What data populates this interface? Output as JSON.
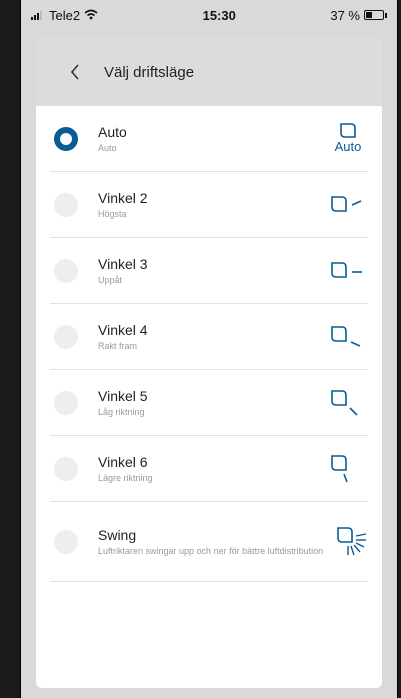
{
  "status_bar": {
    "carrier": "Tele2",
    "time": "15:30",
    "battery": "37 %"
  },
  "header": {
    "title": "Välj driftsläge"
  },
  "modes": [
    {
      "label": "Auto",
      "sublabel": "Auto",
      "selected": true,
      "icon": "auto-mode-icon",
      "icon_text": "Auto"
    },
    {
      "label": "Vinkel 2",
      "sublabel": "Högsta",
      "selected": false,
      "icon": "angle-2-icon"
    },
    {
      "label": "Vinkel 3",
      "sublabel": "Uppåt",
      "selected": false,
      "icon": "angle-3-icon"
    },
    {
      "label": "Vinkel  4",
      "sublabel": "Rakt fram",
      "selected": false,
      "icon": "angle-4-icon"
    },
    {
      "label": "Vinkel  5",
      "sublabel": "Låg riktning",
      "selected": false,
      "icon": "angle-5-icon"
    },
    {
      "label": "Vinkel  6",
      "sublabel": "Lägre riktning",
      "selected": false,
      "icon": "angle-6-icon"
    },
    {
      "label": "Swing",
      "sublabel": "Luftriktaren swingar upp och ner för bättre luftdistribution",
      "selected": false,
      "icon": "swing-icon"
    }
  ],
  "colors": {
    "accent": "#0b5b94"
  }
}
